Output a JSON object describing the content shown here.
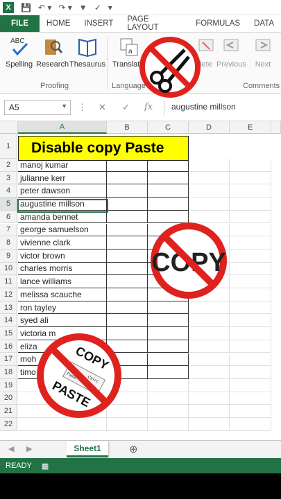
{
  "quick_access": {
    "excel_logo": "X"
  },
  "tabs": [
    "FILE",
    "HOME",
    "INSERT",
    "PAGE LAYOUT",
    "FORMULAS",
    "DATA"
  ],
  "ribbon": {
    "spelling": "Spelling",
    "spelling_top": "ABC",
    "research": "Research",
    "thesaurus": "Thesaurus",
    "translate": "Translate",
    "delete": "lete",
    "previous": "Previous",
    "next": "Next",
    "groups": {
      "proofing": "Proofing",
      "language": "Language",
      "comments": "Comments"
    }
  },
  "formula_bar": {
    "name_box": "A5",
    "fx": "fx",
    "value": "augustine millson"
  },
  "columns": [
    "A",
    "B",
    "C",
    "D",
    "E"
  ],
  "rows": [
    "1",
    "2",
    "3",
    "4",
    "5",
    "6",
    "7",
    "8",
    "9",
    "10",
    "11",
    "12",
    "13",
    "14",
    "15",
    "16",
    "17",
    "18",
    "19",
    "20",
    "21",
    "22"
  ],
  "title_text": "Disable copy Paste",
  "names": [
    "manoj kumar",
    "julianne kerr",
    "peter dawson",
    "augustine millson",
    "amanda bennet",
    "george samuelson",
    "vivienne clark",
    "victor brown",
    "charles morris",
    "lance williams",
    "melissa scauche",
    "ron tayley",
    "syed ali",
    "victoria m",
    "eliza",
    "moh",
    "timo"
  ],
  "stickers": {
    "copy_text": "COPY",
    "copy_paste_top": "COPY",
    "copy_paste_bottom": "PASTE",
    "menu_copy": "Copy",
    "menu_paste": "Paste",
    "shortcut_c": "Ctrl+C",
    "shortcut_v": "Ctrl+V"
  },
  "sheet_tab": "Sheet1",
  "status": {
    "ready": "READY"
  },
  "colors": {
    "excel_green": "#217346",
    "title_fill": "#ffff00",
    "no_sign_red": "#e0221e"
  }
}
